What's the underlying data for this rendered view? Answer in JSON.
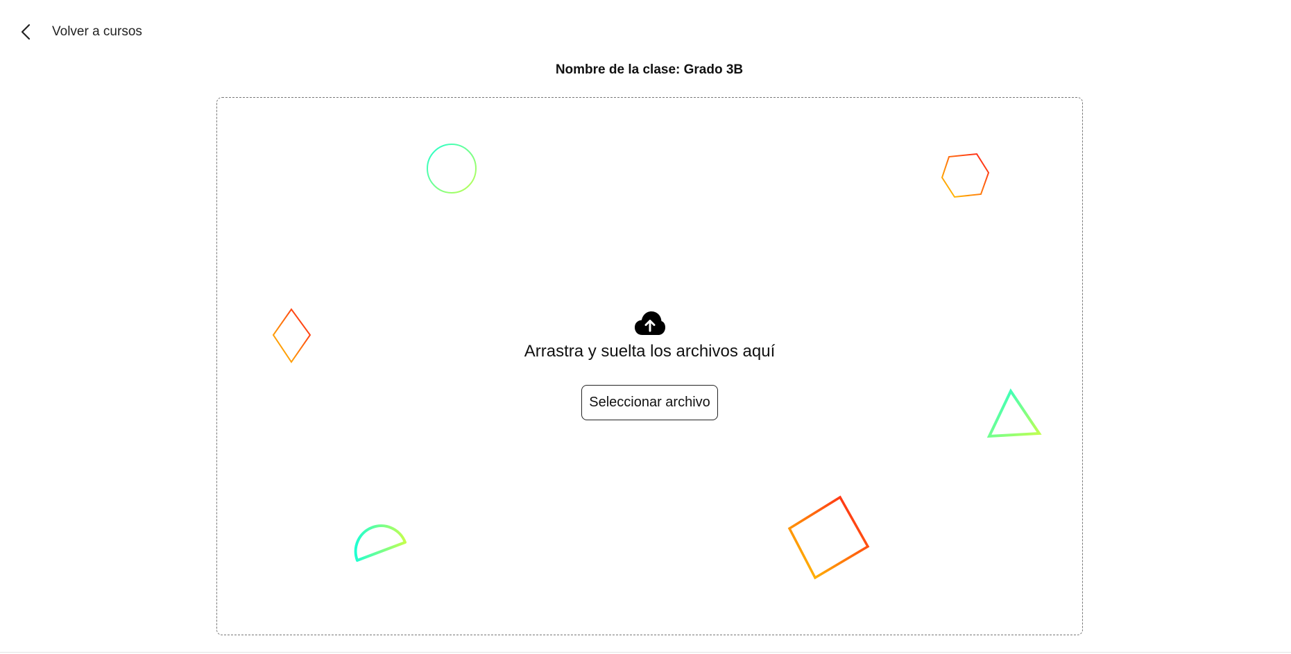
{
  "nav": {
    "back_label": "Volver a cursos",
    "back_icon": "chevron-left-icon"
  },
  "header": {
    "class_title": "Nombre de la clase: Grado 3B"
  },
  "dropzone": {
    "icon": "cloud-upload-icon",
    "prompt": "Arrastra y suelta los archivos aquí",
    "select_button_label": "Seleccionar archivo"
  },
  "colors": {
    "warm_start": "#ff1a1a",
    "warm_end": "#ffcc00",
    "cool_start": "#1effd2",
    "cool_end": "#c4ff4d",
    "border": "#777777",
    "text": "#111111"
  }
}
